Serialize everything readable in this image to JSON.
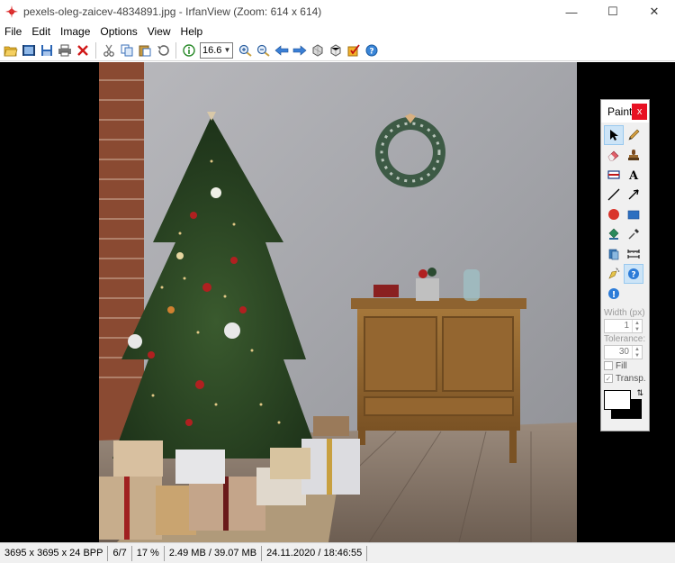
{
  "window": {
    "title": "pexels-oleg-zaicev-4834891.jpg - IrfanView (Zoom: 614 x 614)",
    "controls": {
      "minimize": "—",
      "maximize": "☐",
      "close": "✕"
    }
  },
  "menu": {
    "items": [
      {
        "label": "File"
      },
      {
        "label": "Edit"
      },
      {
        "label": "Image"
      },
      {
        "label": "Options"
      },
      {
        "label": "View"
      },
      {
        "label": "Help"
      }
    ]
  },
  "toolbar": {
    "zoom_value": "16.6",
    "buttons": [
      "open-folder-icon",
      "slideshow-icon",
      "save-icon",
      "print-icon",
      "delete-icon",
      "cut-icon",
      "copy-icon",
      "paste-icon",
      "undo-icon",
      "info-icon",
      "zoom-in-icon",
      "zoom-out-icon",
      "previous-icon",
      "next-icon",
      "rotate-left-icon",
      "rotate-right-icon",
      "paint-icon",
      "help-icon"
    ]
  },
  "paint": {
    "title": "Paint",
    "close": "x",
    "tools": [
      "selection-arrow-icon",
      "pencil-icon",
      "eraser-icon",
      "stamp-icon",
      "redeye-icon",
      "text-icon",
      "line-icon",
      "arrow-line-icon",
      "circle-icon",
      "rectangle-icon",
      "fill-bucket-icon",
      "color-picker-icon",
      "clone-icon",
      "measure-icon",
      "spray-icon",
      "help-icon",
      "info-icon"
    ],
    "width_label": "Width (px)",
    "width_value": "1",
    "tolerance_label": "Tolerance:",
    "tolerance_value": "30",
    "fill_label": "Fill",
    "transp_label": "Transp."
  },
  "status": {
    "dimensions": "3695 x 3695 x 24 BPP",
    "index": "6/7",
    "zoom": "17 %",
    "memory": "2.49 MB / 39.07 MB",
    "datetime": "24.11.2020 / 18:46:55"
  }
}
